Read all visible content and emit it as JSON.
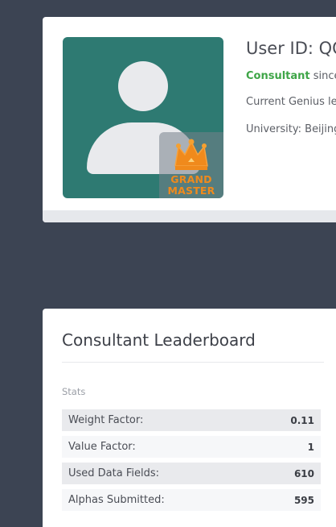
{
  "profile": {
    "user_id": "User ID: QQ",
    "role": "Consultant",
    "role_suffix": " since",
    "genius_text": "Current Genius le",
    "university_text": "University: Beijing",
    "badge": {
      "line1": "GRAND",
      "line2": "MASTER",
      "color": "#f08a1c"
    },
    "avatar_bg": "#2e7a72"
  },
  "leaderboard": {
    "title": "Consultant Leaderboard",
    "stats_label": "Stats",
    "stats": [
      {
        "label": "Weight Factor:",
        "value": "0.11"
      },
      {
        "label": "Value Factor:",
        "value": "1"
      },
      {
        "label": "Used Data Fields:",
        "value": "610"
      },
      {
        "label": "Alphas Submitted:",
        "value": "595"
      }
    ]
  },
  "colors": {
    "page_bg": "#3c4453",
    "role_green": "#3ea547"
  }
}
